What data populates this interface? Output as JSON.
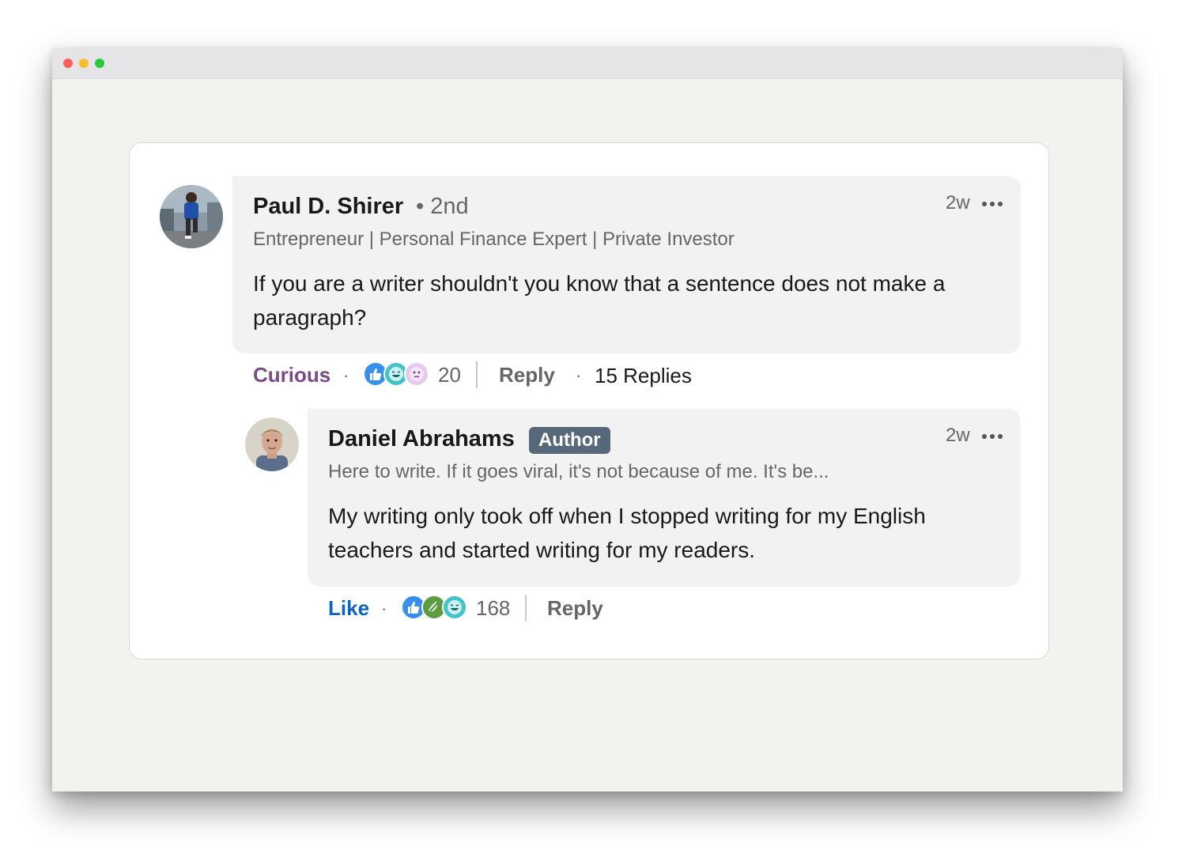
{
  "window": {
    "controls": [
      "close",
      "minimize",
      "zoom"
    ],
    "colors": {
      "close": "#fe5f57",
      "minimize": "#febc2e",
      "zoom": "#28c840"
    }
  },
  "comment": {
    "author": "Paul D. Shirer",
    "degree": "• 2nd",
    "headline": "Entrepreneur | Personal Finance Expert | Private Investor",
    "time": "2w",
    "text": "If you are a writer shouldn't you know that a sentence does not make a paragraph?",
    "reaction_label": "Curious",
    "reaction_color": "#7c4a86",
    "reaction_icons": [
      "like-icon",
      "funny-icon",
      "curious-icon"
    ],
    "reaction_count": "20",
    "reply_label": "Reply",
    "replies_label": "15 Replies"
  },
  "reply": {
    "author": "Daniel Abrahams",
    "badge": "Author",
    "headline": "Here to write. If it goes viral, it's not because of me. It's be...",
    "time": "2w",
    "text": "My writing only took off when I stopped writing for my English teachers and started writing for my readers.",
    "reaction_label": "Like",
    "reaction_color": "#0a66c2",
    "reaction_icons": [
      "like-icon",
      "support-icon",
      "funny-icon"
    ],
    "reaction_count": "168",
    "reply_label": "Reply"
  },
  "separator": "·"
}
